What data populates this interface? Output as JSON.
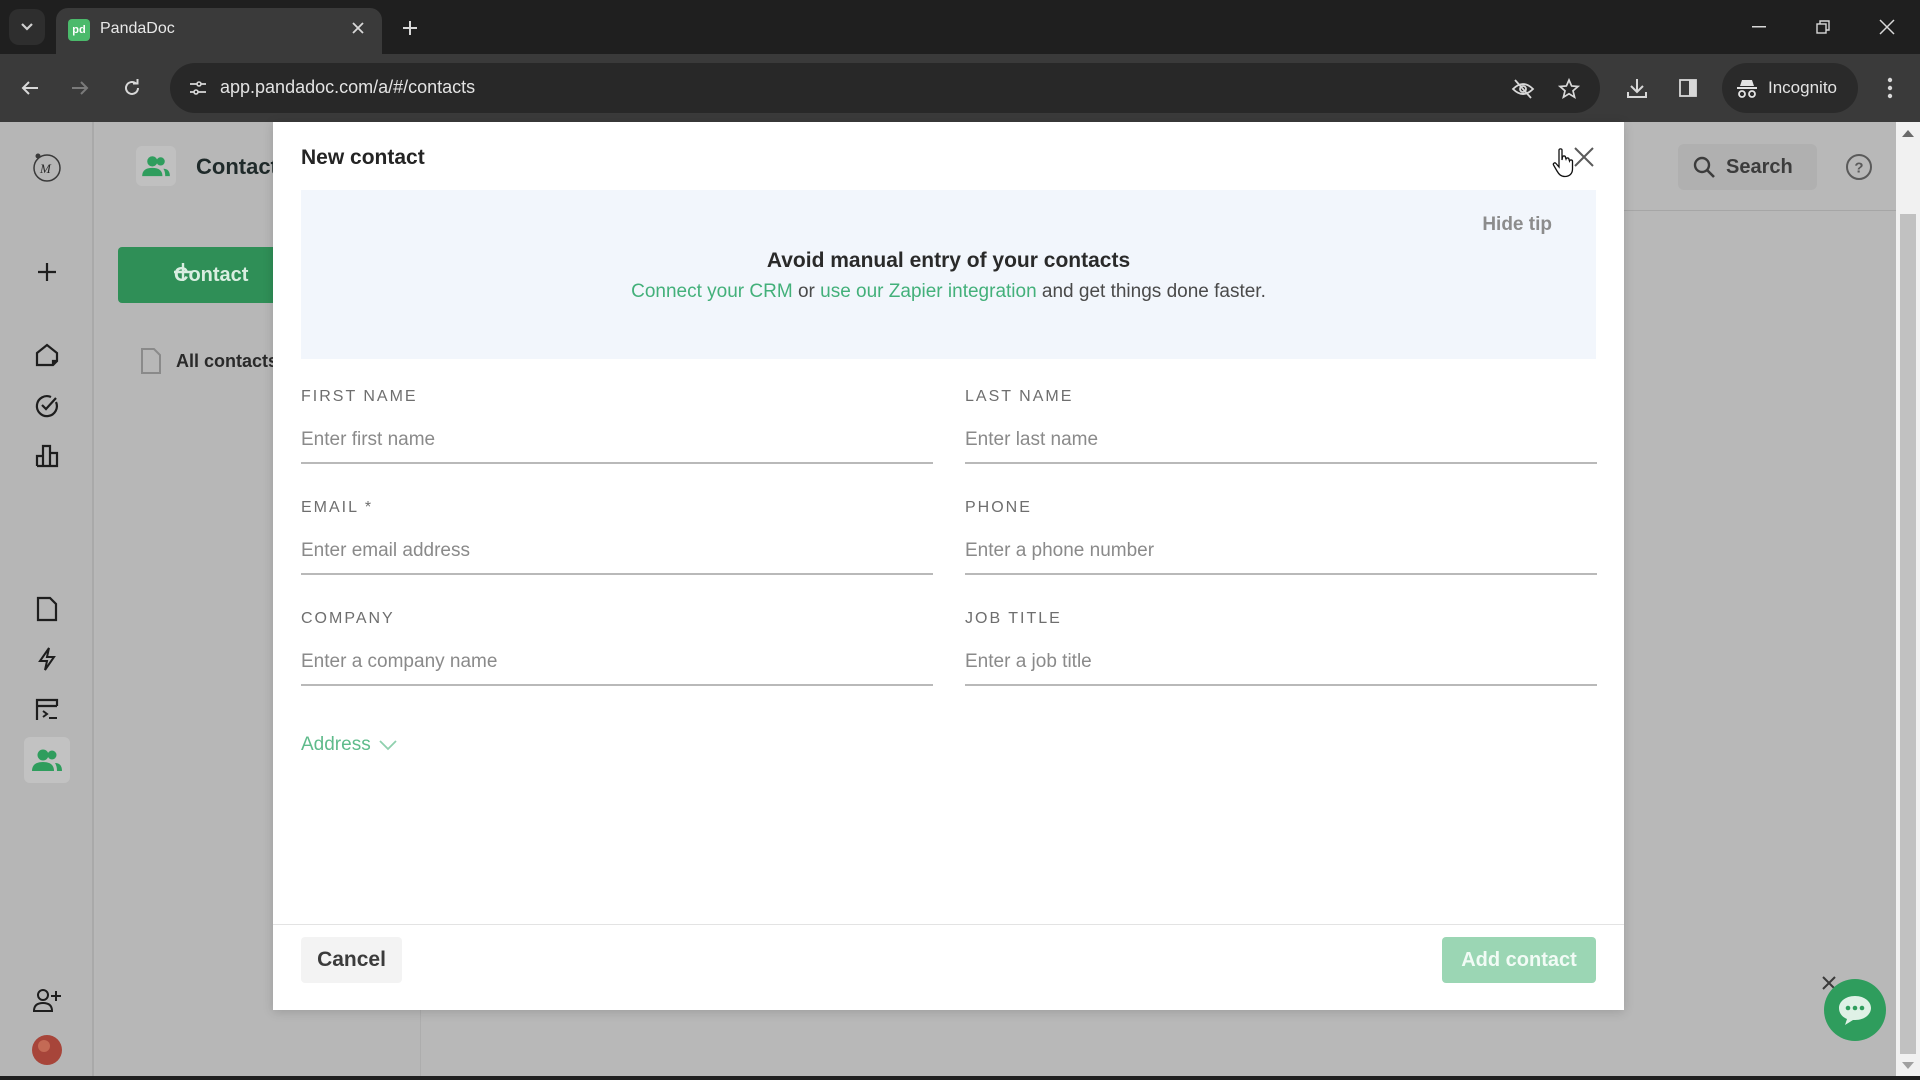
{
  "browser": {
    "tab_title": "PandaDoc",
    "favicon_text": "pd",
    "url": "app.pandadoc.com/a/#/contacts",
    "incognito_label": "Incognito"
  },
  "app": {
    "page_title": "Contacts",
    "add_contact_label": "Contact",
    "all_contacts_label": "All contacts",
    "search_label": "Search",
    "accent_color": "#2f9d5d",
    "nav_items": [
      {
        "name": "profile-logo",
        "active": false
      },
      {
        "name": "create",
        "active": false
      },
      {
        "name": "home",
        "active": false
      },
      {
        "name": "tasks",
        "active": false
      },
      {
        "name": "reports",
        "active": false
      },
      {
        "name": "documents",
        "active": false
      },
      {
        "name": "automations",
        "active": false
      },
      {
        "name": "templates",
        "active": false
      },
      {
        "name": "contacts",
        "active": true
      },
      {
        "name": "invite-user",
        "active": false
      },
      {
        "name": "avatar",
        "active": false
      }
    ]
  },
  "modal": {
    "title": "New contact",
    "tip": {
      "hide_label": "Hide tip",
      "title": "Avoid manual entry of your contacts",
      "link_crm": "Connect your CRM",
      "or_text": " or ",
      "link_zapier": "use our Zapier integration",
      "suffix": " and get things done faster."
    },
    "fields": {
      "first_name": {
        "label": "FIRST NAME",
        "placeholder": "Enter first name",
        "value": ""
      },
      "last_name": {
        "label": "LAST NAME",
        "placeholder": "Enter last name",
        "value": ""
      },
      "email": {
        "label": "EMAIL *",
        "placeholder": "Enter email address",
        "value": ""
      },
      "phone": {
        "label": "PHONE",
        "placeholder": "Enter a phone number",
        "value": ""
      },
      "company": {
        "label": "COMPANY",
        "placeholder": "Enter a company name",
        "value": ""
      },
      "job_title": {
        "label": "JOB TITLE",
        "placeholder": "Enter a job title",
        "value": ""
      }
    },
    "address_label": "Address",
    "cancel_label": "Cancel",
    "submit_label": "Add contact",
    "submit_enabled": false
  }
}
